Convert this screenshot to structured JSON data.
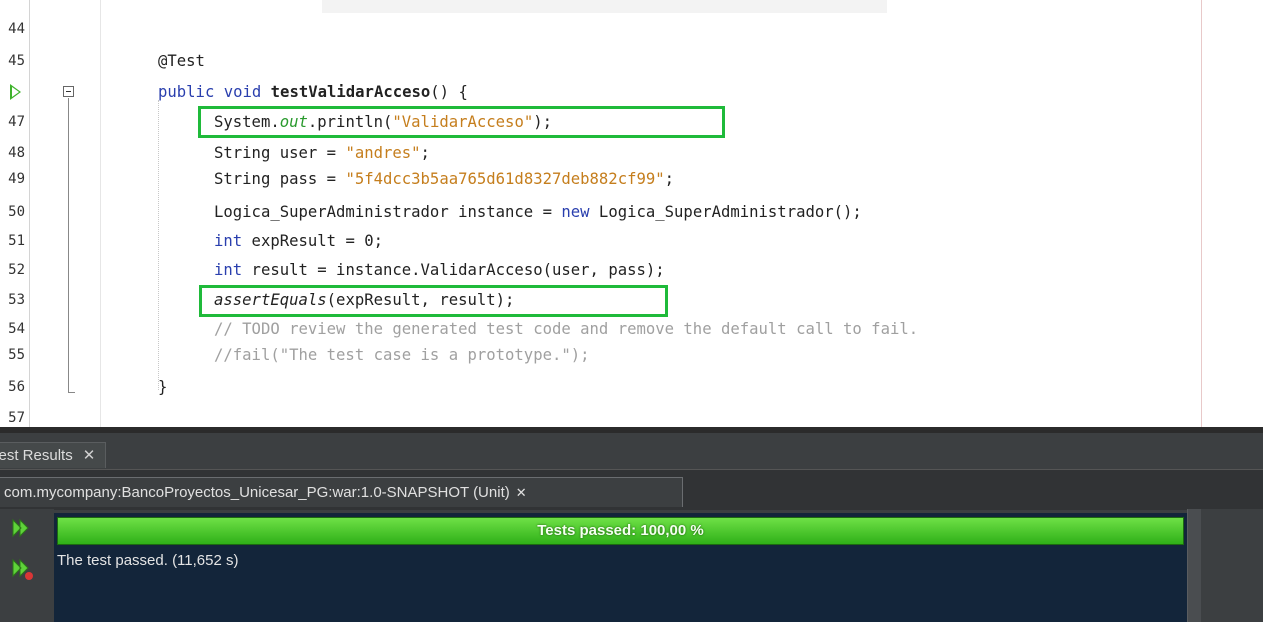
{
  "editor": {
    "lines": [
      {
        "num": "44"
      },
      {
        "num": "45",
        "annotation": "@Test"
      },
      {
        "num": "",
        "kw": "public void ",
        "name": "testValidarAcceso",
        "rest": "() {"
      },
      {
        "num": "47",
        "t1": "System.",
        "field": "out",
        "t2": ".println(",
        "str": "\"ValidarAcceso\"",
        "t3": ");"
      },
      {
        "num": "48",
        "t1": "String user = ",
        "str": "\"andres\"",
        "t3": ";"
      },
      {
        "num": "49",
        "t1": "String pass = ",
        "str": "\"5f4dcc3b5aa765d61d8327deb882cf99\"",
        "t3": ";"
      },
      {
        "num": "50",
        "t1": "Logica_SuperAdministrador instance = ",
        "kw": "new",
        "t2": " Logica_SuperAdministrador();"
      },
      {
        "num": "51",
        "kw": "int",
        "t1": " expResult = 0;"
      },
      {
        "num": "52",
        "kw": "int",
        "t1": " result = instance.ValidarAcceso(user, pass);"
      },
      {
        "num": "53",
        "ital": "assertEquals",
        "t1": "(expResult, result);"
      },
      {
        "num": "54",
        "cmt": "// TODO review the generated test code and remove the default call to fail."
      },
      {
        "num": "55",
        "cmt": "//fail(\"The test case is a prototype.\");"
      },
      {
        "num": "56",
        "t1": "}"
      },
      {
        "num": "57"
      }
    ]
  },
  "panel": {
    "window_tab": "Test Results",
    "window_tab_close": "✕",
    "project_tab": "com.mycompany:BancoProyectos_Unicesar_PG:war:1.0-SNAPSHOT (Unit)",
    "project_tab_close": "✕",
    "progress_label": "Tests passed: 100,00 %",
    "progress_fraction": 1.0,
    "output": "The test passed. (11,652 s)",
    "rerun_icon": "rerun-icon",
    "rerun_failed_icon": "rerun-failed-icon"
  },
  "colors": {
    "highlight_box": "#1fba3a",
    "keyword": "#2a3fae",
    "string": "#c57e1d",
    "progress": "#3fc41f"
  }
}
